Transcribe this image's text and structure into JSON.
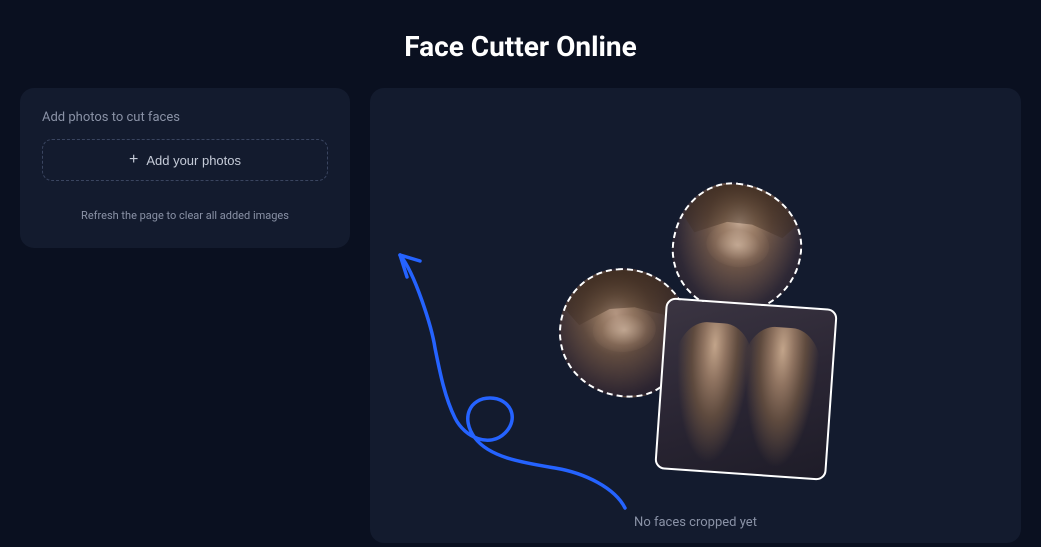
{
  "header": {
    "title": "Face Cutter Online"
  },
  "leftPanel": {
    "label": "Add photos to cut faces",
    "addButtonLabel": "Add your photos",
    "hint": "Refresh the page to clear all added images"
  },
  "rightPanel": {
    "statusText": "No faces cropped yet"
  },
  "colors": {
    "background": "#0a1020",
    "panel": "#131b2e",
    "arrow": "#2563ff",
    "textMuted": "#8a92a6"
  }
}
